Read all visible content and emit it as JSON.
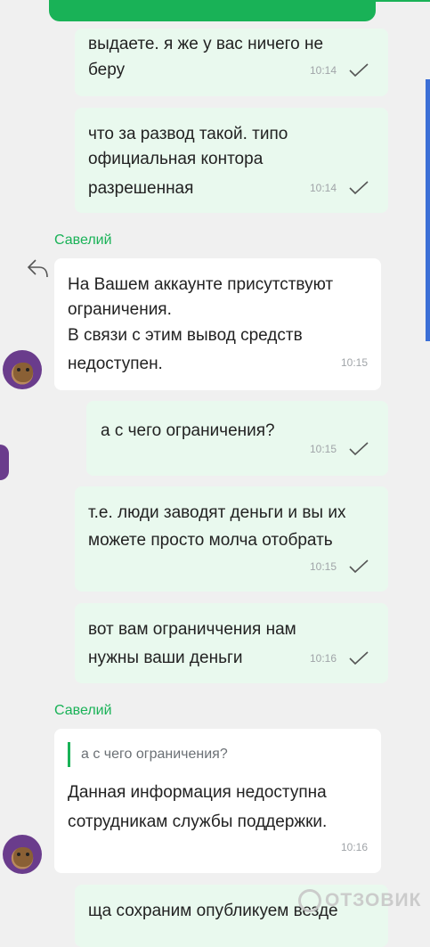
{
  "messages": [
    {
      "lines": [
        "выдаете. я же у вас ничего не",
        "беру"
      ],
      "time": "10:14"
    },
    {
      "lines": [
        "что за развод такой. типо",
        "официальная контора",
        "разрешенная"
      ],
      "time": "10:14"
    },
    {
      "sender": "Савелий",
      "lines": [
        "На Вашем аккаунте присутствуют",
        "ограничения.",
        "В связи с этим вывод средств",
        "недоступен."
      ],
      "time": "10:15"
    },
    {
      "lines": [
        "а с чего ограничения?"
      ],
      "time": "10:15"
    },
    {
      "lines": [
        "т.е. люди заводят деньги и вы их",
        "можете просто молча отобрать"
      ],
      "time": "10:15"
    },
    {
      "lines": [
        "вот вам ограниччения нам",
        "нужны ваши деньги"
      ],
      "time": "10:16"
    },
    {
      "sender": "Савелий",
      "quote": "а с чего ограничения?",
      "lines": [
        "Данная информация недоступна",
        "сотрудникам службы поддержки."
      ],
      "time": "10:16"
    },
    {
      "lines": [
        "ща сохраним опубликуем везде"
      ]
    }
  ],
  "watermark": "ОТЗОВИК",
  "colors": {
    "accent": "#19b257",
    "outgoing_bubble": "#e9f9ee",
    "incoming_bubble": "#ffffff",
    "background": "#f0f0f0"
  }
}
